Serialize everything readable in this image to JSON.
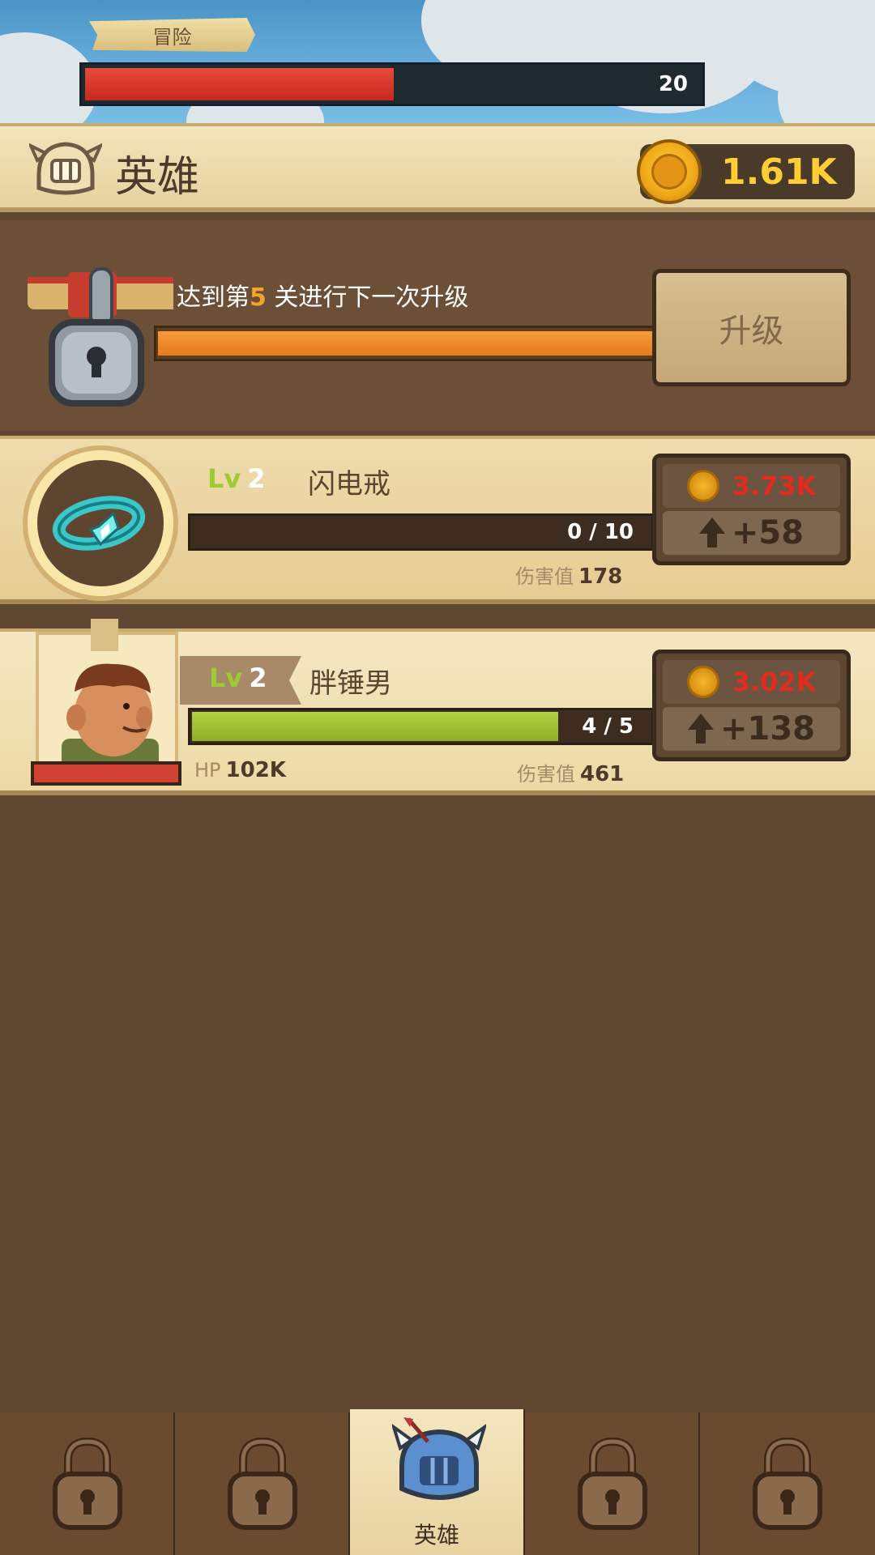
{
  "top": {
    "tag_label": "冒险",
    "hp_value": "20",
    "hp_fraction": 0.5
  },
  "header": {
    "title": "英雄",
    "gold": "1.61K"
  },
  "lock_row": {
    "text_prefix": "达到第",
    "text_highlight": "5",
    "text_suffix": " 关进行下一次升级",
    "progress_fraction": 1.0,
    "button_label": "升级"
  },
  "items": [
    {
      "lv_prefix": "Lv",
      "level": "2",
      "name": "闪电戒",
      "progress": "0 / 10",
      "progress_fraction": 0.0,
      "stat_label": "伤害值",
      "stat_value": "178",
      "cost": "3.73K",
      "bonus": "+58"
    },
    {
      "lv_prefix": "Lv",
      "level": "2",
      "name": "胖锤男",
      "progress": "4 / 5",
      "progress_fraction": 0.8,
      "hp_label": "HP",
      "hp_value": "102K",
      "stat_label": "伤害值",
      "stat_value": "461",
      "cost": "3.02K",
      "bonus": "+138"
    }
  ],
  "bottom_nav": {
    "active_label": "英雄"
  },
  "colors": {
    "gold_text": "#ffce33",
    "cost_red": "#e02b1e",
    "level_green": "#9ccc31",
    "progress_orange": "#e47c1d"
  }
}
